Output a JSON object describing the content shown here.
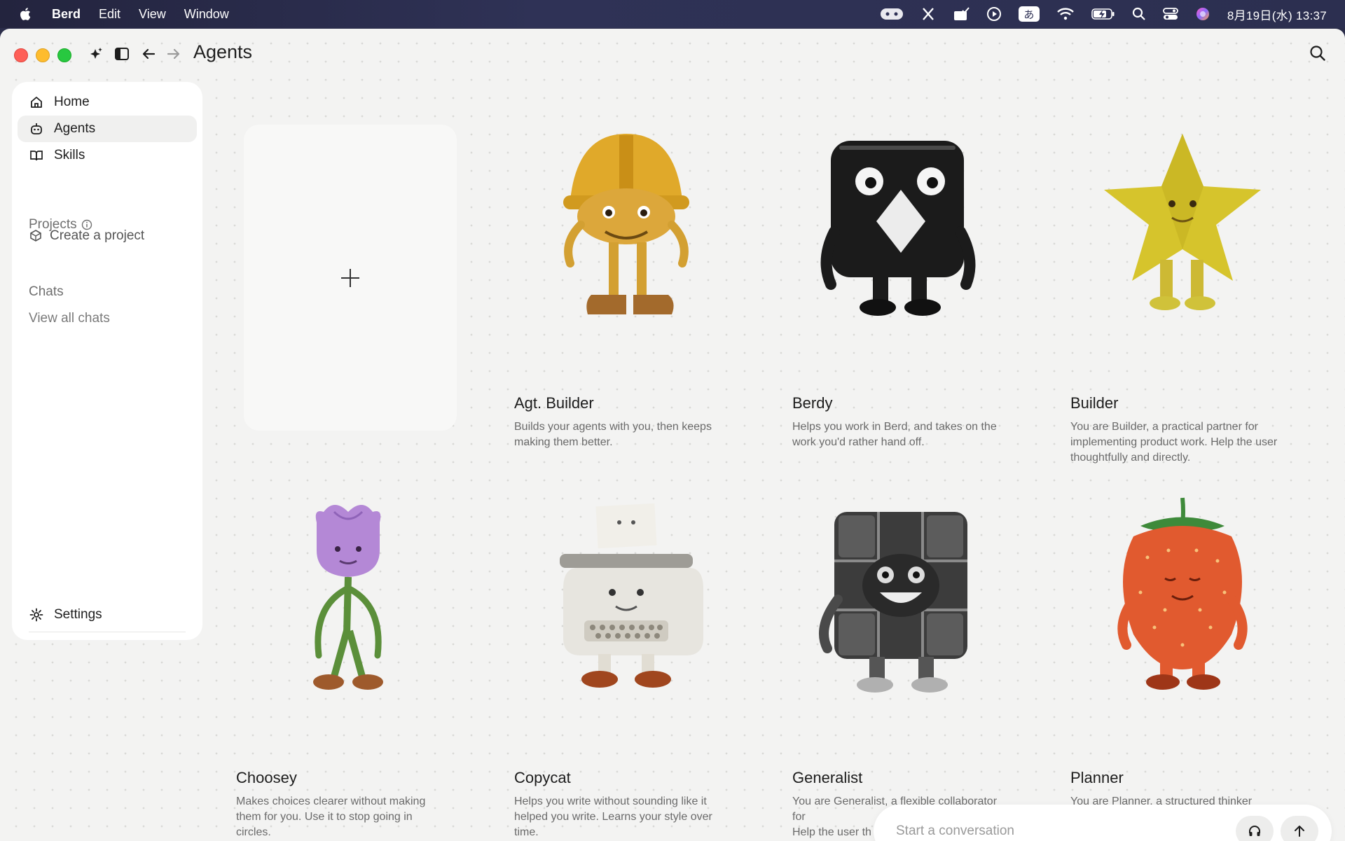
{
  "menubar": {
    "app_name": "Berd",
    "items": [
      "Edit",
      "View",
      "Window"
    ],
    "clock": "8月19日(水) 13:37",
    "input_method": "あ"
  },
  "titlebar": {
    "title": "Agents"
  },
  "sidebar": {
    "nav": [
      {
        "label": "Home",
        "icon": "home-icon"
      },
      {
        "label": "Agents",
        "icon": "robot-icon"
      },
      {
        "label": "Skills",
        "icon": "book-icon"
      }
    ],
    "projects_label": "Projects",
    "create_project": "Create a project",
    "chats_label": "Chats",
    "view_all_chats": "View all chats",
    "settings": "Settings"
  },
  "agents": [
    {
      "name": "Agt. Builder",
      "desc": "Builds your agents with you, then keeps making them better.",
      "figure": "hardhat-character"
    },
    {
      "name": "Berdy",
      "desc": "Helps you work in Berd, and takes on the work you'd rather hand off.",
      "figure": "black-cube-character"
    },
    {
      "name": "Builder",
      "desc": "You are Builder, a practical partner for implementing product work. Help the user thoughtfully and directly.",
      "figure": "star-character"
    },
    {
      "name": "Choosey",
      "desc": "Makes choices clearer without making them for you. Use it to stop going in circles.",
      "figure": "tulip-character"
    },
    {
      "name": "Copycat",
      "desc": "Helps you write without sounding like it helped you write. Learns your style over time.",
      "figure": "typewriter-character"
    },
    {
      "name": "Generalist",
      "desc": "You are Generalist, a flexible collaborator for",
      "desc_line3": "Help the user th",
      "figure": "chrome-cube-character"
    },
    {
      "name": "Planner",
      "desc": "You are Planner, a structured thinker",
      "figure": "strawberry-character"
    }
  ],
  "composer": {
    "placeholder": "Start a conversation"
  },
  "colors": {
    "window_bg": "#f3f3f2",
    "accent_red": "#fe5f57",
    "accent_yellow": "#febc2e",
    "accent_green": "#28c840"
  }
}
